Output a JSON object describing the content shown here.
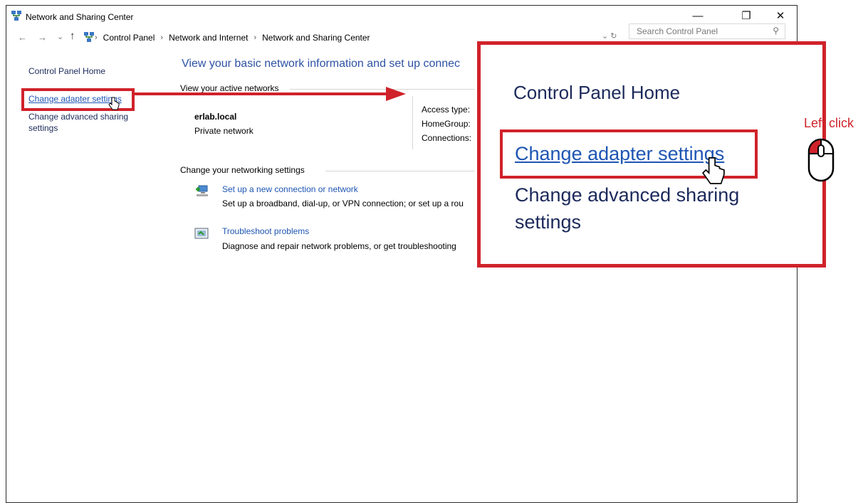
{
  "window": {
    "title": "Network and Sharing Center",
    "controls": {
      "minimize": "—",
      "restore": "❐",
      "close": "✕"
    }
  },
  "address_bar": {
    "back": "←",
    "forward": "→",
    "recent": "⌄",
    "up": "↑",
    "crumbs": [
      "Control Panel",
      "Network and Internet",
      "Network and Sharing Center"
    ],
    "separator": "›",
    "dropdown": "⌄ ↻"
  },
  "search": {
    "placeholder": "Search Control Panel",
    "icon": "⚲"
  },
  "sidebar": {
    "home": "Control Panel Home",
    "adapter_link": "Change adapter settings",
    "advanced_line1": "Change advanced sharing",
    "advanced_line2": "settings"
  },
  "main": {
    "heading": "View your basic network information and set up connec",
    "active_networks_label": "View your active networks",
    "network": {
      "name": "erlab.local",
      "type": "Private network"
    },
    "properties": [
      "Access type:",
      "HomeGroup:",
      "Connections:"
    ],
    "change_settings_label": "Change your networking settings",
    "tasks": [
      {
        "title": "Set up a new connection or network",
        "desc": "Set up a broadband, dial-up, or VPN connection; or set up a rou"
      },
      {
        "title": "Troubleshoot problems",
        "desc": "Diagnose and repair network problems, or get troubleshooting"
      }
    ]
  },
  "zoom": {
    "home": "Control Panel Home",
    "adapter_link": "Change adapter settings",
    "advanced_line1": "Change advanced sharing",
    "advanced_line2": "settings"
  },
  "annotation": {
    "instruction": "Left click"
  },
  "colors": {
    "annotation_red": "#d0222a",
    "link_blue": "#1e55b3"
  }
}
